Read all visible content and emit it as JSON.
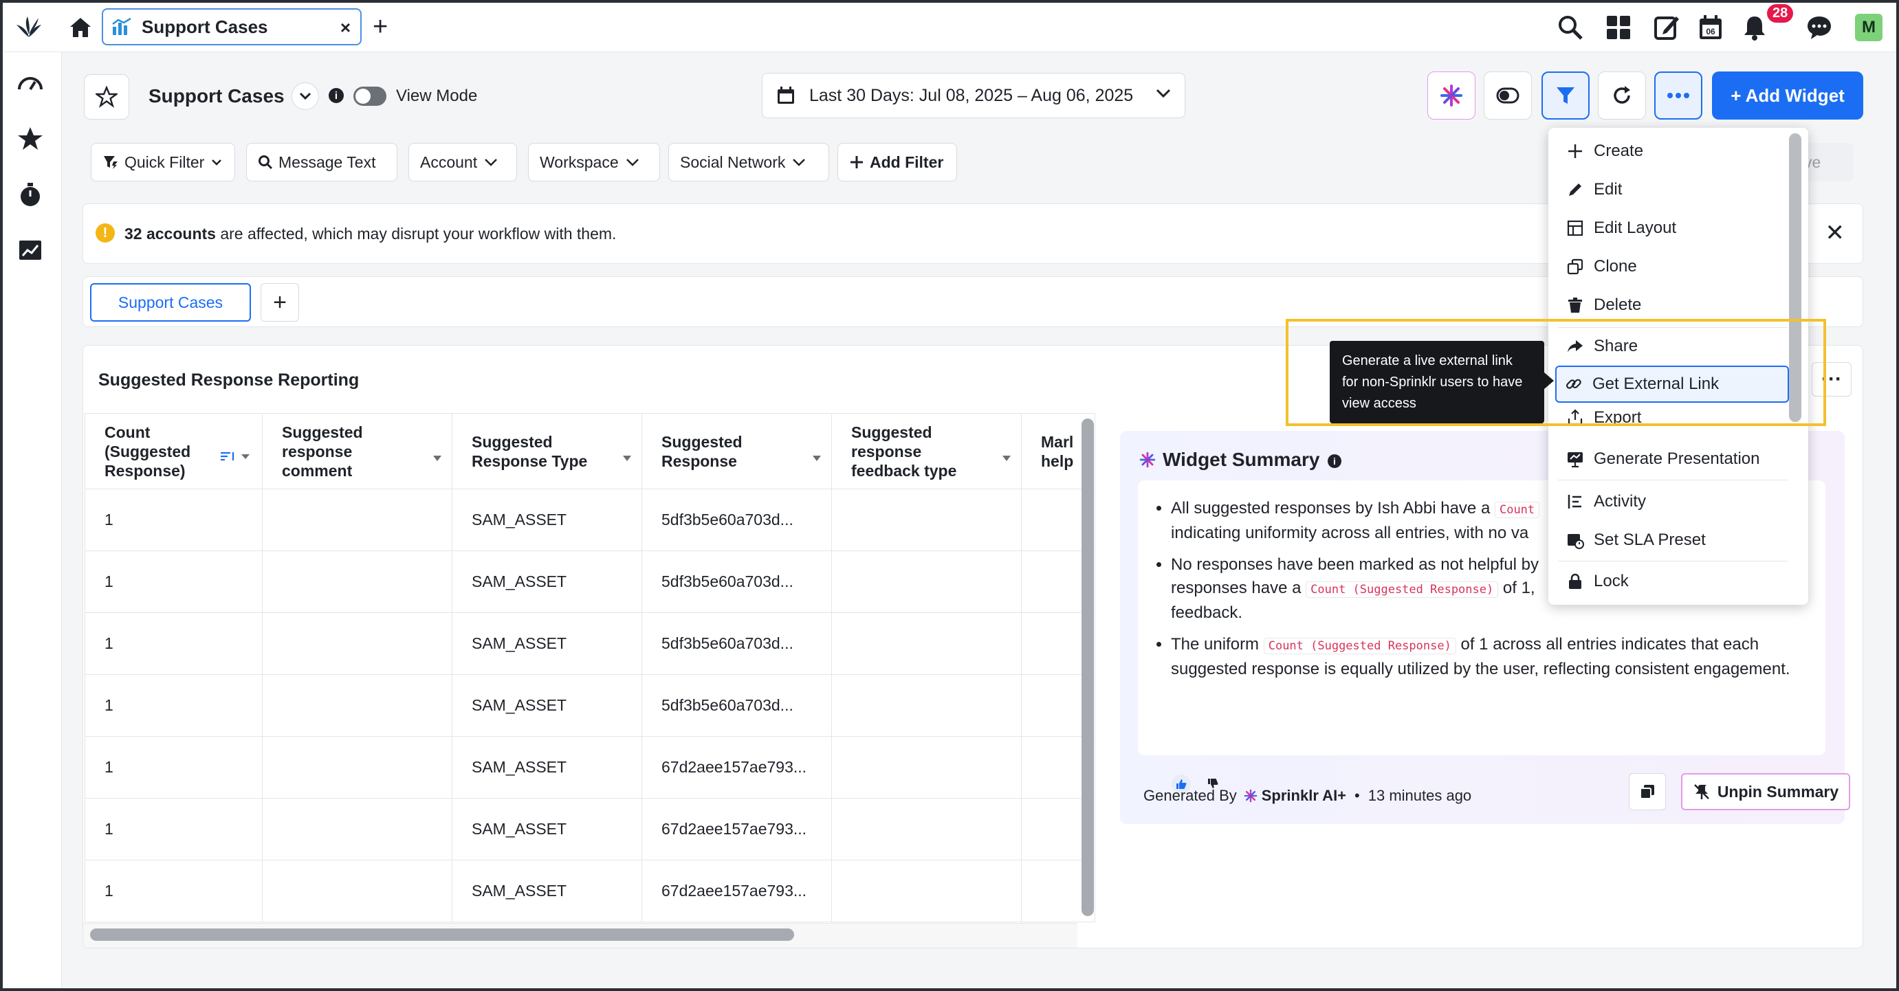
{
  "topbar": {
    "tab_label": "Support Cases",
    "tab_close": "×",
    "add_tab": "+",
    "notification_count": "28",
    "user_initial": "M",
    "calendar_day": "06"
  },
  "header": {
    "title": "Support Cases",
    "view_mode_label": "View Mode",
    "date_range": "Last 30 Days: Jul 08, 2025 – Aug 06, 2025",
    "add_widget_label": "+ Add Widget"
  },
  "filters": {
    "quick_filter": "Quick Filter",
    "message_text": "Message Text",
    "account": "Account",
    "workspace": "Workspace",
    "social_network": "Social Network",
    "add_filter": "Add Filter",
    "save": "ve"
  },
  "warning": {
    "bold": "32 accounts",
    "text": " are affected, which may disrupt your workflow with them."
  },
  "page_tabs": {
    "active": "Support Cases",
    "add": "+"
  },
  "widget": {
    "title": "Suggested Response Reporting",
    "columns": [
      "Count (Suggested Response)",
      "Suggested response comment",
      "Suggested Response Type",
      "Suggested Response",
      "Suggested response feedback type",
      "Marl help"
    ],
    "rows": [
      [
        "1",
        "",
        "SAM_ASSET",
        "5df3b5e60a703d...",
        "",
        ""
      ],
      [
        "1",
        "",
        "SAM_ASSET",
        "5df3b5e60a703d...",
        "",
        ""
      ],
      [
        "1",
        "",
        "SAM_ASSET",
        "5df3b5e60a703d...",
        "",
        ""
      ],
      [
        "1",
        "",
        "SAM_ASSET",
        "5df3b5e60a703d...",
        "",
        ""
      ],
      [
        "1",
        "",
        "SAM_ASSET",
        "67d2aee157ae793...",
        "",
        ""
      ],
      [
        "1",
        "",
        "SAM_ASSET",
        "67d2aee157ae793...",
        "",
        ""
      ],
      [
        "1",
        "",
        "SAM_ASSET",
        "67d2aee157ae793...",
        "",
        ""
      ]
    ]
  },
  "summary": {
    "title": "Widget Summary",
    "bullet1_a": "All suggested responses by Ish Abbi have a ",
    "bullet1_code": "Count",
    "bullet1_b": " indicating uniformity across all entries, with no va",
    "bullet2_a": "No responses have been marked as not helpful by",
    "bullet2_b": " responses have a ",
    "bullet2_code": "Count (Suggested Response)",
    "bullet2_c": " of 1,",
    "bullet2_d": " feedback.",
    "bullet3_a": "The uniform ",
    "bullet3_code": "Count (Suggested Response)",
    "bullet3_b": " of 1 across all entries indicates that each suggested response is equally utilized by the user, reflecting consistent engagement.",
    "generated_by": "Generated By",
    "generator": "Sprinklr AI+",
    "separator": "•",
    "time_ago": "13 minutes ago",
    "unpin_label": "Unpin Summary",
    "info_action": "i"
  },
  "menu": {
    "items": [
      "Create",
      "Edit",
      "Edit Layout",
      "Clone",
      "Delete",
      "Share",
      "Get External Link",
      "Export",
      "Generate Presentation",
      "Activity",
      "Set SLA Preset",
      "Lock"
    ]
  },
  "tooltip": {
    "text": "Generate a live external link for non-Sprinklr users to have view access"
  },
  "colors": {
    "accent": "#1b6ef3",
    "highlight": "#f2c12e",
    "warning": "#f3b616",
    "badge": "#e5194a"
  }
}
